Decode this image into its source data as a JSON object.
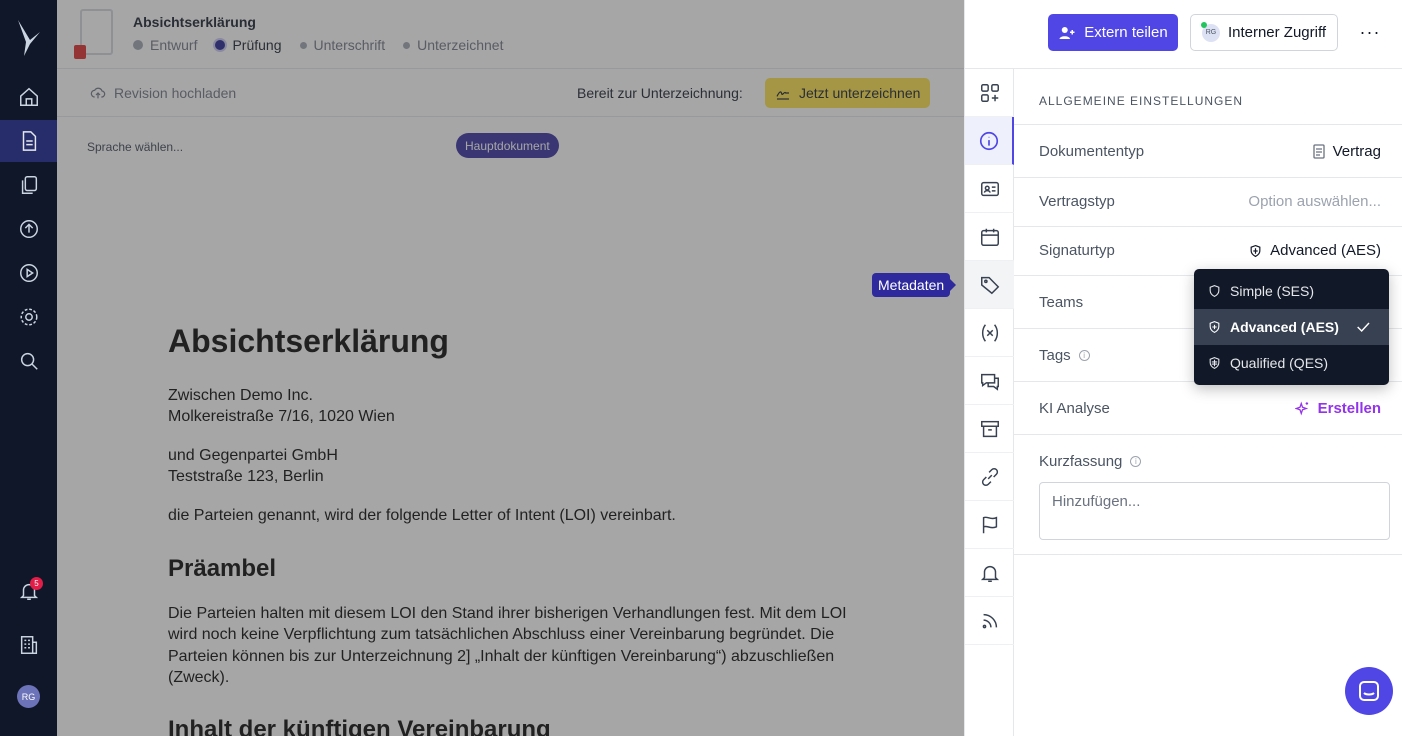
{
  "document": {
    "title": "Absichtserklärung",
    "steps": [
      {
        "label": "Entwurf",
        "state": "done"
      },
      {
        "label": "Prüfung",
        "state": "current"
      },
      {
        "label": "Unterschrift",
        "state": "pending"
      },
      {
        "label": "Unterzeichnet",
        "state": "pending"
      }
    ]
  },
  "toolbar": {
    "upload_label": "Revision hochladen",
    "ready_label": "Bereit zur Unterzeichnung:",
    "sign_label": "Jetzt unterzeichnen"
  },
  "subbar": {
    "language_label": "Sprache wählen...",
    "main_doc_badge": "Hauptdokument"
  },
  "paper": {
    "heading": "Absichtserklärung",
    "party1_line1": "Zwischen Demo Inc.",
    "party1_line2": "Molkereistraße 7/16, 1020 Wien",
    "party2_line1": "und Gegenpartei GmbH",
    "party2_line2": "Teststraße 123, Berlin",
    "intro": "die Parteien genannt, wird der folgende Letter of Intent (LOI) vereinbart.",
    "section1_title": "Präambel",
    "section1_line1": "Die Parteien halten mit diesem LOI den Stand ihrer bisherigen Verhandlungen fest. Mit dem LOI",
    "section1_line2": "wird noch keine Verpflichtung zum tatsächlichen Abschluss einer Vereinbarung begründet. Die",
    "section1_line3": "Parteien können bis zur Unterzeichnung 2] „Inhalt der künftigen Vereinbarung“) abzuschließen",
    "section1_line4": "(Zweck).",
    "section2_title": "Inhalt der künftigen Vereinbarung"
  },
  "tooltip": "Metadaten",
  "header": {
    "share_label": "Extern teilen",
    "access_label": "Interner Zugriff",
    "access_avatar": "RG",
    "more_label": "···"
  },
  "settings": {
    "section_title": "ALLGEMEINE EINSTELLUNGEN",
    "rows": {
      "doctype_label": "Dokumententyp",
      "doctype_value": "Vertrag",
      "contracttype_label": "Vertragstyp",
      "contracttype_value": "Option auswählen...",
      "signature_label": "Signaturtyp",
      "signature_value": "Advanced (AES)",
      "teams_label": "Teams",
      "tags_label": "Tags",
      "ai_label": "KI Analyse",
      "ai_value": "Erstellen",
      "summary_label": "Kurzfassung",
      "summary_placeholder": "Hinzufügen..."
    }
  },
  "dropdown": {
    "options": [
      {
        "label": "Simple (SES)",
        "selected": false
      },
      {
        "label": "Advanced (AES)",
        "selected": true
      },
      {
        "label": "Qualified (QES)",
        "selected": false
      }
    ]
  },
  "leftnav": {
    "notification_count": "5",
    "user_initials": "RG"
  },
  "colors": {
    "accent": "#4f46e5",
    "nav_bg": "#0f1729",
    "sign_yellow": "#fde047",
    "ai_purple": "#9333ea"
  }
}
